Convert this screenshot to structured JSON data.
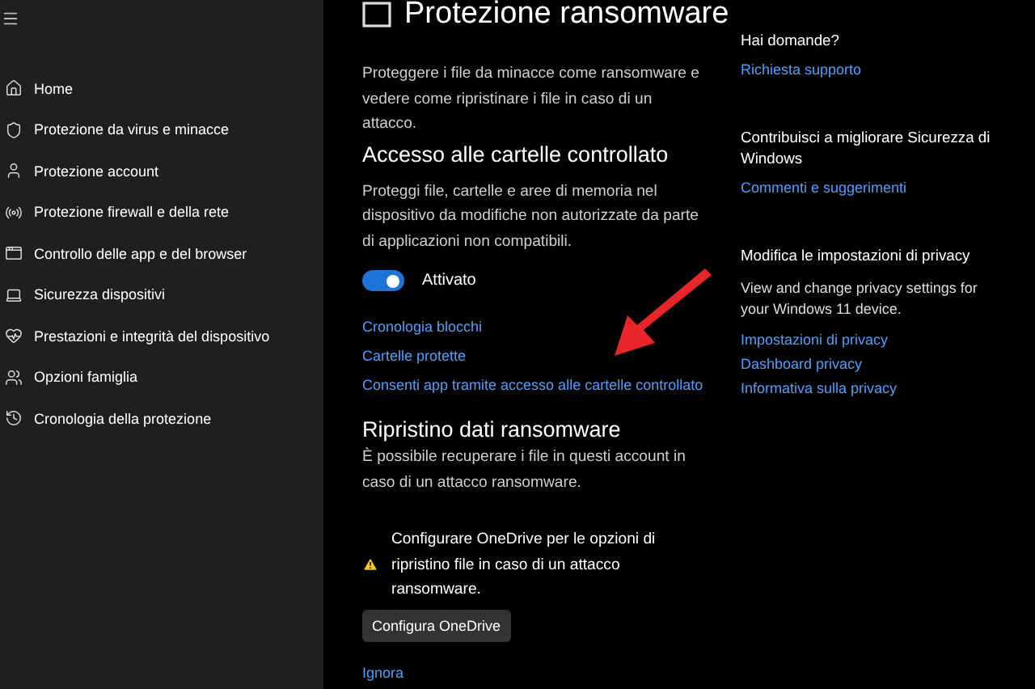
{
  "sidebar": {
    "items": [
      {
        "label": "Home",
        "selected": false
      },
      {
        "label": "Protezione da virus e minacce",
        "selected": false
      },
      {
        "label": "Protezione account",
        "selected": false
      },
      {
        "label": "Protezione firewall e della rete",
        "selected": false
      },
      {
        "label": "Controllo delle app e del browser",
        "selected": false
      },
      {
        "label": "Sicurezza dispositivi",
        "selected": false
      },
      {
        "label": "Prestazioni e integrità del dispositivo",
        "selected": false
      },
      {
        "label": "Opzioni famiglia",
        "selected": false
      },
      {
        "label": "Cronologia della protezione",
        "selected": false
      }
    ]
  },
  "page": {
    "title": "Protezione ransomware",
    "description": "Proteggere i file da minacce come ransomware e vedere come ripristinare i file in caso di un attacco.",
    "cfa": {
      "heading": "Accesso alle cartelle controllato",
      "description": "Proteggi file, cartelle e aree di memoria nel dispositivo da modifiche non autorizzate da parte di applicazioni non compatibili.",
      "toggle": {
        "on": true,
        "label": "Attivato"
      },
      "links": [
        "Cronologia blocchi",
        "Cartelle protette",
        "Consenti app tramite accesso alle cartelle controllato"
      ]
    },
    "recovery": {
      "heading": "Ripristino dati ransomware",
      "description": "È possibile recuperare i file in questi account in caso di un attacco ransomware.",
      "warning": "Configurare OneDrive per le opzioni di ripristino file in caso di un attacco ransomware.",
      "button": "Configura OneDrive",
      "link": "Ignora"
    }
  },
  "aside": [
    {
      "heading": "Hai domande?",
      "links": [
        "Richiesta supporto"
      ]
    },
    {
      "heading": "Contribuisci a migliorare Sicurezza di Windows",
      "links": [
        "Commenti e suggerimenti"
      ]
    },
    {
      "heading": "Modifica le impostazioni di privacy",
      "description": "View and change privacy settings for your Windows 11 device.",
      "links": [
        "Impostazioni di privacy",
        "Dashboard privacy",
        "Informativa sulla privacy"
      ]
    }
  ]
}
